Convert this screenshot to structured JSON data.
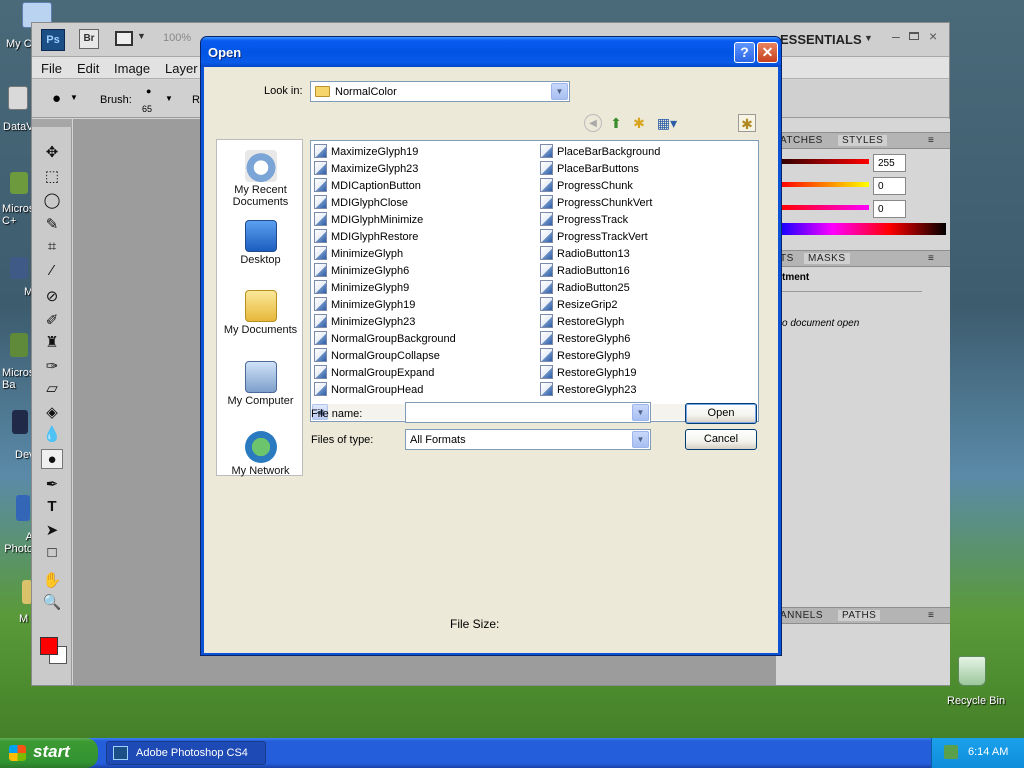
{
  "desktop": {
    "icons": [
      "My C",
      "DataV",
      "Micros C+",
      "M",
      "Micros Ba",
      "Dev",
      "A Photo",
      "M"
    ],
    "recycle_bin": "Recycle Bin"
  },
  "photoshop": {
    "logo": "Ps",
    "bridge": "Br",
    "zoom": "100%",
    "workspace": "ESSENTIALS",
    "menu": [
      "File",
      "Edit",
      "Image",
      "Layer"
    ],
    "options": {
      "brush_label": "Brush:",
      "brush_size": "65",
      "r_label": "R"
    },
    "panels": {
      "swatches_tab": "ATCHES",
      "styles_tab": "STYLES",
      "color_values": [
        "255",
        "0",
        "0"
      ],
      "layers_tab": "TS",
      "masks_tab": "MASKS",
      "adjustments_title": "tment",
      "no_document": "o document open",
      "channels_tab": "ANNELS",
      "paths_tab": "PATHS"
    },
    "colors": {
      "foreground": "#ff0000",
      "background": "#ffffff"
    }
  },
  "dialog": {
    "title": "Open",
    "look_in_label": "Look in:",
    "look_in_value": "NormalColor",
    "places": [
      "My Recent Documents",
      "Desktop",
      "My Documents",
      "My Computer",
      "My Network"
    ],
    "files_col1": [
      "MaximizeGlyph19",
      "MaximizeGlyph23",
      "MDICaptionButton",
      "MDIGlyphClose",
      "MDIGlyphMinimize",
      "MDIGlyphRestore",
      "MinimizeGlyph",
      "MinimizeGlyph6",
      "MinimizeGlyph9",
      "MinimizeGlyph19",
      "MinimizeGlyph23",
      "NormalGroupBackground",
      "NormalGroupCollapse",
      "NormalGroupExpand",
      "NormalGroupHead"
    ],
    "files_col2": [
      "PlaceBarBackground",
      "PlaceBarButtons",
      "ProgressChunk",
      "ProgressChunkVert",
      "ProgressTrack",
      "ProgressTrackVert",
      "RadioButton13",
      "RadioButton16",
      "RadioButton25",
      "ResizeGrip2",
      "RestoreGlyph",
      "RestoreGlyph6",
      "RestoreGlyph9",
      "RestoreGlyph19",
      "RestoreGlyph23"
    ],
    "file_name_label": "File name:",
    "file_name_value": "",
    "files_of_type_label": "Files of type:",
    "files_of_type_value": "All Formats",
    "open_button": "Open",
    "cancel_button": "Cancel",
    "file_size_label": "File Size:"
  },
  "taskbar": {
    "start": "start",
    "task": "Adobe Photoshop CS4",
    "clock": "6:14 AM"
  }
}
